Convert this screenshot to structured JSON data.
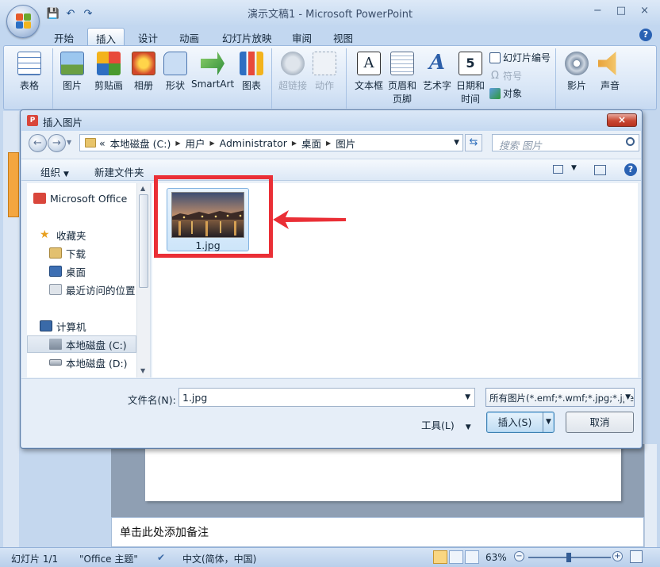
{
  "app": {
    "title": "演示文稿1 - Microsoft PowerPoint",
    "quick_access": [
      "💾",
      "↶",
      "↷"
    ],
    "win_controls": [
      "−",
      "□",
      "×"
    ]
  },
  "ribbon_tabs": [
    {
      "label": "开始",
      "active": false
    },
    {
      "label": "插入",
      "active": true
    },
    {
      "label": "设计",
      "active": false
    },
    {
      "label": "动画",
      "active": false
    },
    {
      "label": "幻灯片放映",
      "active": false
    },
    {
      "label": "审阅",
      "active": false
    },
    {
      "label": "视图",
      "active": false
    }
  ],
  "ribbon": {
    "table": "表格",
    "picture": "图片",
    "clipart": "剪贴画",
    "album": "相册",
    "shapes": "形状",
    "smartart": "SmartArt",
    "chart": "图表",
    "hyperlink": "超链接",
    "action": "动作",
    "textbox": "文本框",
    "header_footer_1": "页眉和",
    "header_footer_2": "页脚",
    "wordart": "艺术字",
    "datetime_1": "日期和",
    "datetime_2": "时间",
    "slide_number": "幻灯片编号",
    "symbol": "符号",
    "object": "对象",
    "movie": "影片",
    "sound": "声音",
    "datetime_digit": "5"
  },
  "dialog": {
    "title": "插入图片",
    "close": "×",
    "breadcrumb_prefix": "«",
    "breadcrumb": [
      "本地磁盘 (C:)",
      "用户",
      "Administrator",
      "桌面",
      "图片"
    ],
    "search_placeholder": "搜索 图片",
    "organize": "组织",
    "new_folder": "新建文件夹",
    "nav": {
      "ms_office": "Microsoft Office",
      "favorites": "收藏夹",
      "downloads": "下载",
      "desktop": "桌面",
      "recent": "最近访问的位置",
      "computer": "计算机",
      "drive_c": "本地磁盘 (C:)",
      "drive_d": "本地磁盘 (D:)"
    },
    "file": {
      "name": "1.jpg"
    },
    "filename_label": "文件名(N):",
    "filename_value": "1.jpg",
    "filetype": "所有图片(*.emf;*.wmf;*.jpg;*.jpeg;*.jfif;*.png;*.bmp;*.gif)",
    "tools": "工具(L)",
    "insert": "插入(S)",
    "cancel": "取消"
  },
  "slide": {
    "notes": "单击此处添加备注"
  },
  "status": {
    "slide": "幻灯片 1/1",
    "theme": "\"Office 主题\"",
    "language": "中文(简体，中国)",
    "zoom": "63%"
  },
  "colors": {
    "highlight": "#ea2f36",
    "accent": "#2a62b3"
  }
}
